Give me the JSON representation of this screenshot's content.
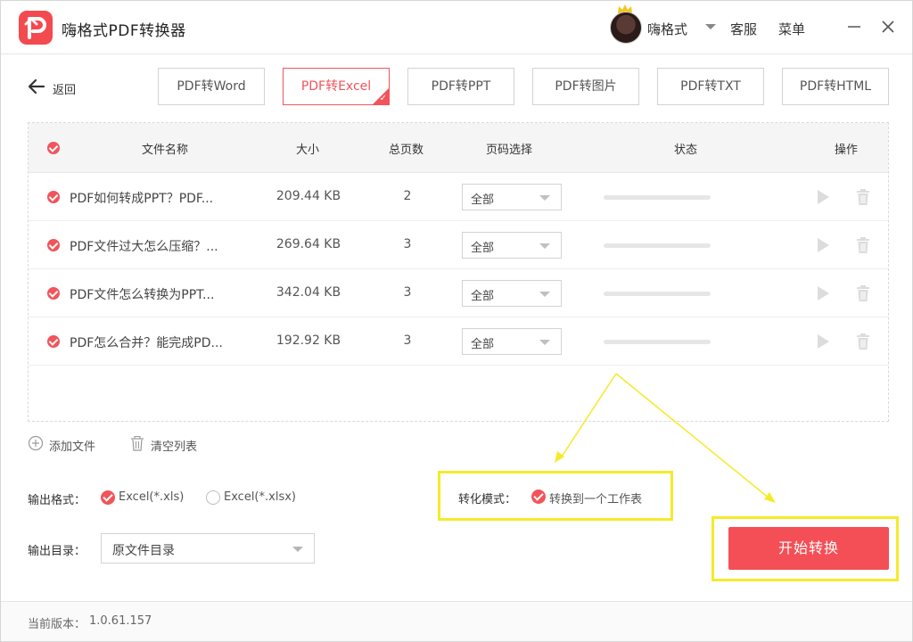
{
  "app": {
    "title": "嗨格式PDF转换器",
    "username": "嗨格式",
    "service_label": "客服",
    "menu_label": "菜单"
  },
  "nav": {
    "back_label": "返回",
    "tabs": [
      {
        "label": "PDF转Word",
        "active": false
      },
      {
        "label": "PDF转Excel",
        "active": true
      },
      {
        "label": "PDF转PPT",
        "active": false
      },
      {
        "label": "PDF转图片",
        "active": false
      },
      {
        "label": "PDF转TXT",
        "active": false
      },
      {
        "label": "PDF转HTML",
        "active": false
      }
    ]
  },
  "table": {
    "headers": {
      "name": "文件名称",
      "size": "大小",
      "pages": "总页数",
      "page_select": "页码选择",
      "status": "状态",
      "actions": "操作"
    },
    "rows": [
      {
        "name": "PDF如何转成PPT？PDF...",
        "size": "209.44 KB",
        "pages": "2",
        "page_range": "全部",
        "progress": 0
      },
      {
        "name": "PDF文件过大怎么压缩？...",
        "size": "269.64 KB",
        "pages": "3",
        "page_range": "全部",
        "progress": 0
      },
      {
        "name": "PDF文件怎么转换为PPT...",
        "size": "342.04 KB",
        "pages": "3",
        "page_range": "全部",
        "progress": 0
      },
      {
        "name": "PDF怎么合并？能完成PD...",
        "size": "192.92 KB",
        "pages": "3",
        "page_range": "全部",
        "progress": 0
      }
    ]
  },
  "controls": {
    "add_file": "添加文件",
    "clear_list": "清空列表"
  },
  "output": {
    "format_label": "输出格式：",
    "format_options": [
      {
        "label": "Excel(*.xls)",
        "selected": true
      },
      {
        "label": "Excel(*.xlsx)",
        "selected": false
      }
    ],
    "dir_label": "输出目录：",
    "dir_value": "原文件目录",
    "mode_label": "转化模式：",
    "mode_option": "转换到一个工作表",
    "mode_selected": true
  },
  "start_button": "开始转换",
  "footer": {
    "version_label": "当前版本：",
    "version": "1.0.61.157"
  },
  "colors": {
    "accent": "#f2545b",
    "highlight": "#f5ea29"
  }
}
